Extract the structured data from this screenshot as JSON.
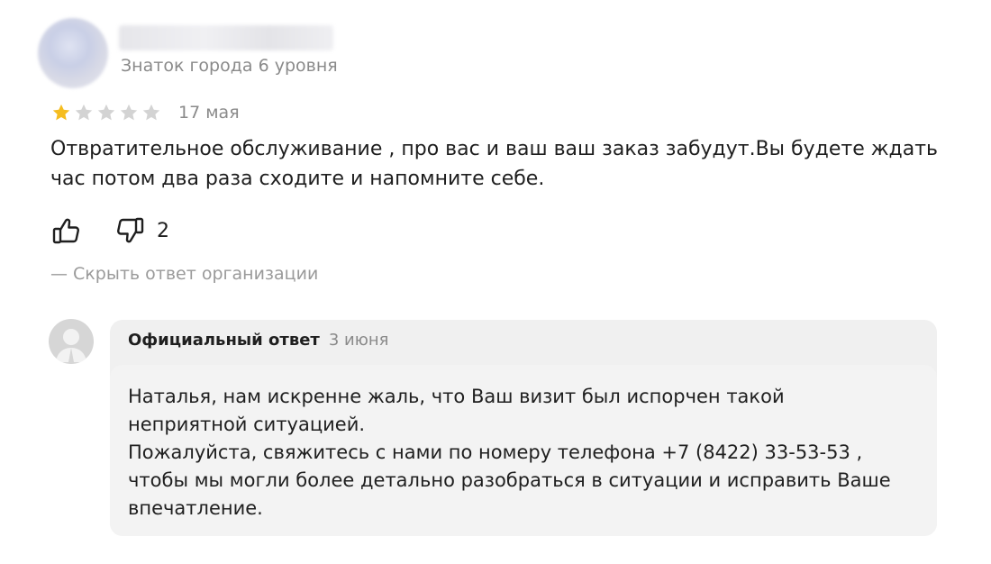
{
  "review": {
    "author_level": "Знаток города 6 уровня",
    "rating": 1,
    "rating_max": 5,
    "date": "17 мая",
    "text": "Отвратительное обслуживание , про вас и ваш ваш заказ забудут.Вы будете ждать час потом два раза сходите и напомните себе.",
    "dislike_count": "2",
    "hide_answer_label": "— Скрыть ответ организации"
  },
  "answer": {
    "title": "Официальный ответ",
    "date": "3 июня",
    "text": "Наталья, нам искренне жаль, что Ваш визит был испорчен такой\nнеприятной ситуацией.\nПожалуйста, свяжитесь с нами по номеру телефона +7 (8422) 33-53-53 ,\nчтобы мы могли более детально разобраться в ситуации и исправить Ваше\nвпечатление."
  },
  "colors": {
    "star_filled": "#f5bd1f",
    "star_empty": "#d3d3d3",
    "muted_text": "#8a8a8a",
    "card_bg": "#f0f0f0"
  },
  "icons": {
    "like": "thumbs-up-icon",
    "dislike": "thumbs-down-icon",
    "star": "star-icon",
    "org_avatar": "user-silhouette-icon"
  }
}
